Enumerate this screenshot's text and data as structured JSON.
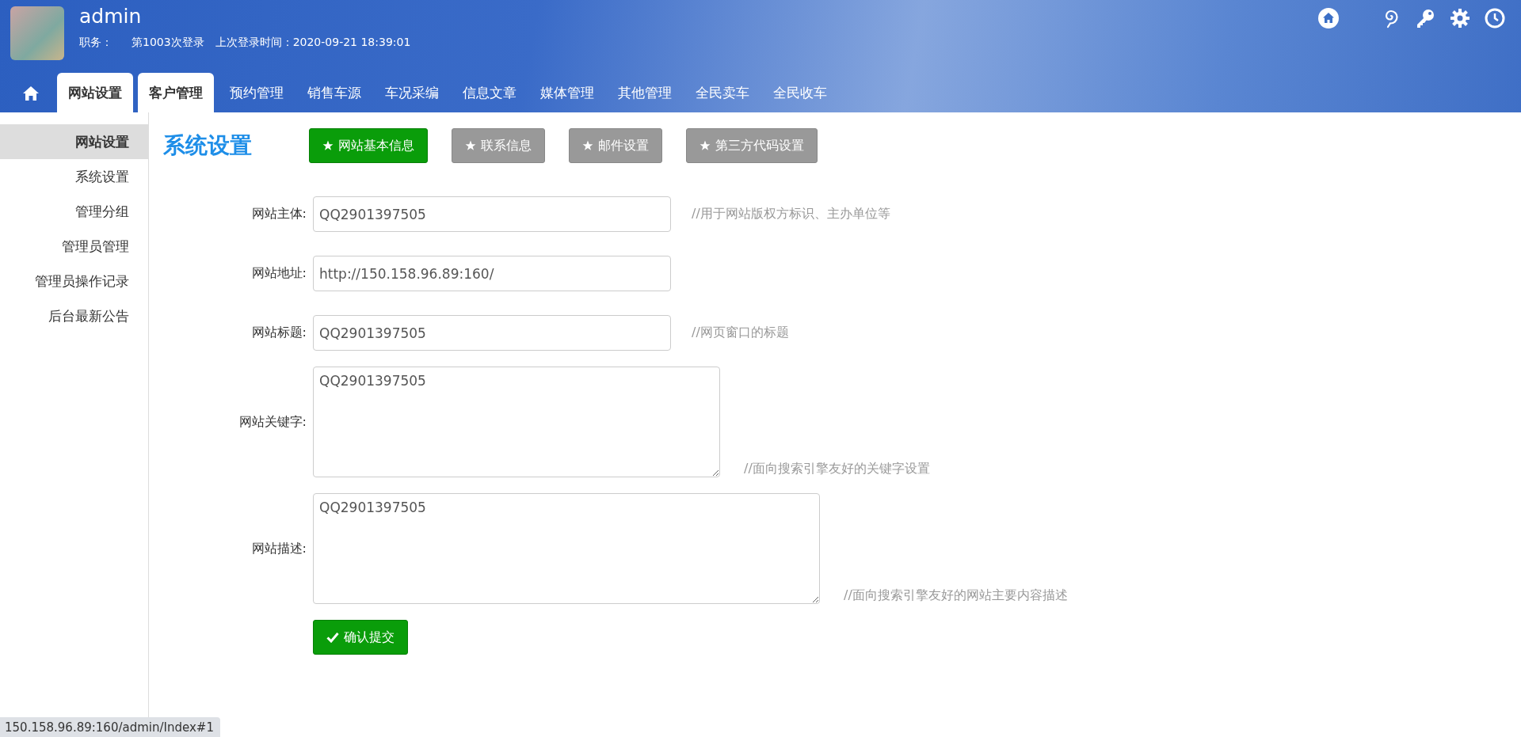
{
  "user": {
    "name": "admin",
    "role_label": "职务：",
    "login_count": "第1003次登录",
    "last_login": "上次登录时间：2020-09-21 18:39:01"
  },
  "nav_tabs": [
    {
      "label": "网站设置",
      "selected": true
    },
    {
      "label": "客户管理",
      "selected": true
    },
    {
      "label": "预约管理",
      "selected": false
    },
    {
      "label": "销售车源",
      "selected": false
    },
    {
      "label": "车况采编",
      "selected": false
    },
    {
      "label": "信息文章",
      "selected": false
    },
    {
      "label": "媒体管理",
      "selected": false
    },
    {
      "label": "其他管理",
      "selected": false
    },
    {
      "label": "全民卖车",
      "selected": false
    },
    {
      "label": "全民收车",
      "selected": false
    }
  ],
  "sidebar": {
    "items": [
      {
        "label": "网站设置",
        "selected": true
      },
      {
        "label": "系统设置",
        "selected": false
      },
      {
        "label": "管理分组",
        "selected": false
      },
      {
        "label": "管理员管理",
        "selected": false
      },
      {
        "label": "管理员操作记录",
        "selected": false
      },
      {
        "label": "后台最新公告",
        "selected": false
      }
    ]
  },
  "page_title": "系统设置",
  "section_buttons": [
    {
      "label": "网站基本信息",
      "selected": true
    },
    {
      "label": "联系信息",
      "selected": false
    },
    {
      "label": "邮件设置",
      "selected": false
    },
    {
      "label": "第三方代码设置",
      "selected": false
    }
  ],
  "form": [
    {
      "kind": "input",
      "label": "网站主体:",
      "value": "QQ2901397505",
      "hint": "//用于网站版权方标识、主办单位等"
    },
    {
      "kind": "input",
      "label": "网站地址:",
      "value": "http://150.158.96.89:160/"
    },
    {
      "kind": "input",
      "label": "网站标题:",
      "value": "QQ2901397505",
      "hint": "//网页窗口的标题"
    },
    {
      "kind": "textarea",
      "label": "网站关键字:",
      "value": "QQ2901397505",
      "hint": "//面向搜索引擎友好的关键字设置"
    },
    {
      "kind": "widetextarea",
      "label": "网站描述:",
      "value": "QQ2901397505",
      "hint": "//面向搜索引擎友好的网站主要内容描述"
    }
  ],
  "submit_button": "确认提交",
  "status_bar": "150.158.96.89:160/admin/Index#1"
}
